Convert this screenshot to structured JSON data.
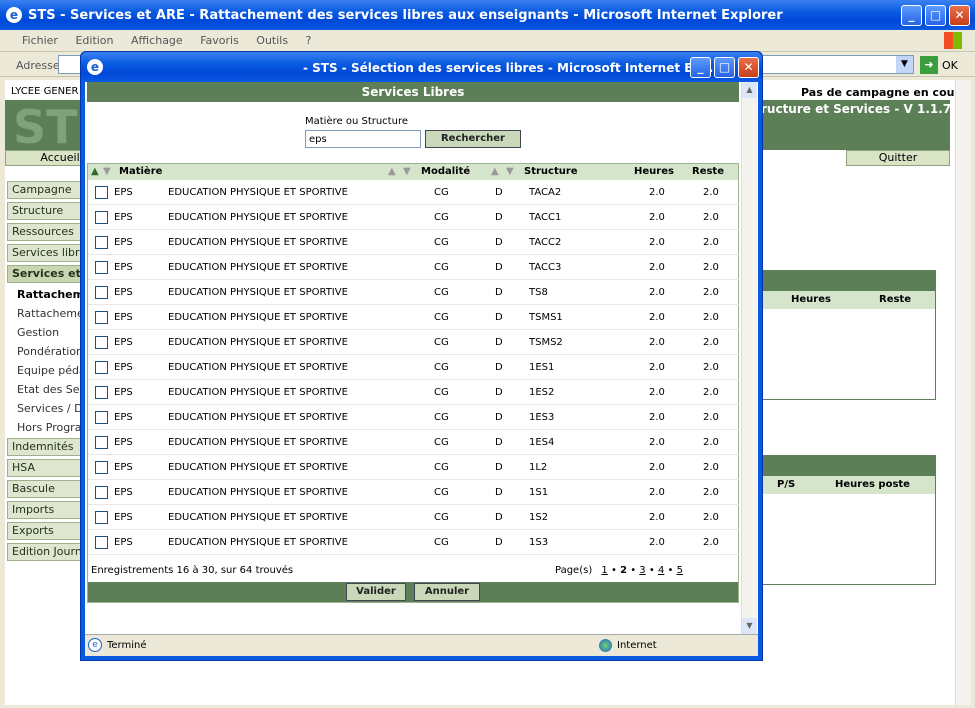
{
  "main_window": {
    "title": "STS - Services et ARE - Rattachement des services libres aux enseignants - Microsoft Internet Explorer",
    "menu": [
      "Fichier",
      "Edition",
      "Affichage",
      "Favoris",
      "Outils",
      "?"
    ],
    "address_label": "Adresse",
    "go_label": "OK"
  },
  "app": {
    "school": "LYCEE GENER",
    "campaign_status": "Pas de campagne en cours",
    "module_title": "ructure et Services - V 1.1.7",
    "logo": "ST",
    "home_tab": "Accueil",
    "quit_tab": "Quitter",
    "sidebar": [
      {
        "label": "Campagne"
      },
      {
        "label": "Structure"
      },
      {
        "label": "Ressources"
      },
      {
        "label": "Services libre"
      },
      {
        "label": "Services et A"
      }
    ],
    "subitems": [
      "Rattacheme",
      "Rattacheme",
      "Gestion",
      "Pondération",
      "Equipe péda",
      "Etat des Se",
      "Services / D",
      "Hors Progra"
    ],
    "sidebar2": [
      "Indemnités",
      "HSA",
      "Bascule",
      "Imports",
      "Exports",
      "Edition Journ"
    ],
    "table1_headers": {
      "heures": "Heures",
      "reste": "Reste"
    },
    "table2_headers": {
      "ps": "P/S",
      "heures_poste": "Heures poste"
    }
  },
  "popup": {
    "title": "- STS - Sélection des services libres - Microsoft Internet Exp...",
    "header": "Services Libres",
    "search_label": "Matière ou Structure",
    "search_value": "eps",
    "search_button": "Rechercher",
    "columns": {
      "matiere": "Matière",
      "modalite": "Modalité",
      "structure": "Structure",
      "heures": "Heures",
      "reste": "Reste"
    },
    "rows": [
      {
        "code": "EPS",
        "label": "EDUCATION PHYSIQUE ET SPORTIVE",
        "mod": "CG",
        "type": "D",
        "structure": "TACA2",
        "heures": "2.0",
        "reste": "2.0"
      },
      {
        "code": "EPS",
        "label": "EDUCATION PHYSIQUE ET SPORTIVE",
        "mod": "CG",
        "type": "D",
        "structure": "TACC1",
        "heures": "2.0",
        "reste": "2.0"
      },
      {
        "code": "EPS",
        "label": "EDUCATION PHYSIQUE ET SPORTIVE",
        "mod": "CG",
        "type": "D",
        "structure": "TACC2",
        "heures": "2.0",
        "reste": "2.0"
      },
      {
        "code": "EPS",
        "label": "EDUCATION PHYSIQUE ET SPORTIVE",
        "mod": "CG",
        "type": "D",
        "structure": "TACC3",
        "heures": "2.0",
        "reste": "2.0"
      },
      {
        "code": "EPS",
        "label": "EDUCATION PHYSIQUE ET SPORTIVE",
        "mod": "CG",
        "type": "D",
        "structure": "TS8",
        "heures": "2.0",
        "reste": "2.0"
      },
      {
        "code": "EPS",
        "label": "EDUCATION PHYSIQUE ET SPORTIVE",
        "mod": "CG",
        "type": "D",
        "structure": "TSMS1",
        "heures": "2.0",
        "reste": "2.0"
      },
      {
        "code": "EPS",
        "label": "EDUCATION PHYSIQUE ET SPORTIVE",
        "mod": "CG",
        "type": "D",
        "structure": "TSMS2",
        "heures": "2.0",
        "reste": "2.0"
      },
      {
        "code": "EPS",
        "label": "EDUCATION PHYSIQUE ET SPORTIVE",
        "mod": "CG",
        "type": "D",
        "structure": "1ES1",
        "heures": "2.0",
        "reste": "2.0"
      },
      {
        "code": "EPS",
        "label": "EDUCATION PHYSIQUE ET SPORTIVE",
        "mod": "CG",
        "type": "D",
        "structure": "1ES2",
        "heures": "2.0",
        "reste": "2.0"
      },
      {
        "code": "EPS",
        "label": "EDUCATION PHYSIQUE ET SPORTIVE",
        "mod": "CG",
        "type": "D",
        "structure": "1ES3",
        "heures": "2.0",
        "reste": "2.0"
      },
      {
        "code": "EPS",
        "label": "EDUCATION PHYSIQUE ET SPORTIVE",
        "mod": "CG",
        "type": "D",
        "structure": "1ES4",
        "heures": "2.0",
        "reste": "2.0"
      },
      {
        "code": "EPS",
        "label": "EDUCATION PHYSIQUE ET SPORTIVE",
        "mod": "CG",
        "type": "D",
        "structure": "1L2",
        "heures": "2.0",
        "reste": "2.0"
      },
      {
        "code": "EPS",
        "label": "EDUCATION PHYSIQUE ET SPORTIVE",
        "mod": "CG",
        "type": "D",
        "structure": "1S1",
        "heures": "2.0",
        "reste": "2.0"
      },
      {
        "code": "EPS",
        "label": "EDUCATION PHYSIQUE ET SPORTIVE",
        "mod": "CG",
        "type": "D",
        "structure": "1S2",
        "heures": "2.0",
        "reste": "2.0"
      },
      {
        "code": "EPS",
        "label": "EDUCATION PHYSIQUE ET SPORTIVE",
        "mod": "CG",
        "type": "D",
        "structure": "1S3",
        "heures": "2.0",
        "reste": "2.0"
      }
    ],
    "records_text": "Enregistrements 16 à 30, sur 64 trouvés",
    "pages_label": "Page(s)",
    "pages": [
      "1",
      "2",
      "3",
      "4",
      "5"
    ],
    "validate": "Valider",
    "cancel": "Annuler",
    "status_done": "Terminé",
    "status_zone": "Internet"
  }
}
